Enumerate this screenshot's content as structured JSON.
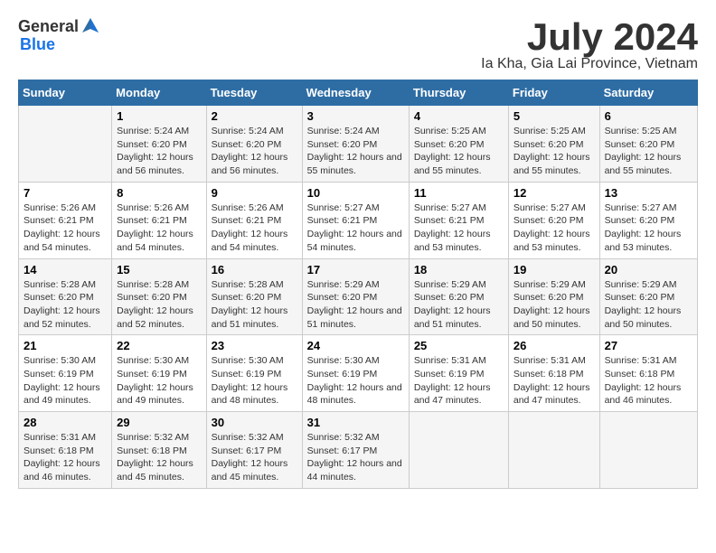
{
  "header": {
    "logo_general": "General",
    "logo_blue": "Blue",
    "month_year": "July 2024",
    "location": "Ia Kha, Gia Lai Province, Vietnam"
  },
  "days_of_week": [
    "Sunday",
    "Monday",
    "Tuesday",
    "Wednesday",
    "Thursday",
    "Friday",
    "Saturday"
  ],
  "weeks": [
    [
      {
        "day": "",
        "sunrise": "",
        "sunset": "",
        "daylight": ""
      },
      {
        "day": "1",
        "sunrise": "Sunrise: 5:24 AM",
        "sunset": "Sunset: 6:20 PM",
        "daylight": "Daylight: 12 hours and 56 minutes."
      },
      {
        "day": "2",
        "sunrise": "Sunrise: 5:24 AM",
        "sunset": "Sunset: 6:20 PM",
        "daylight": "Daylight: 12 hours and 56 minutes."
      },
      {
        "day": "3",
        "sunrise": "Sunrise: 5:24 AM",
        "sunset": "Sunset: 6:20 PM",
        "daylight": "Daylight: 12 hours and 55 minutes."
      },
      {
        "day": "4",
        "sunrise": "Sunrise: 5:25 AM",
        "sunset": "Sunset: 6:20 PM",
        "daylight": "Daylight: 12 hours and 55 minutes."
      },
      {
        "day": "5",
        "sunrise": "Sunrise: 5:25 AM",
        "sunset": "Sunset: 6:20 PM",
        "daylight": "Daylight: 12 hours and 55 minutes."
      },
      {
        "day": "6",
        "sunrise": "Sunrise: 5:25 AM",
        "sunset": "Sunset: 6:20 PM",
        "daylight": "Daylight: 12 hours and 55 minutes."
      }
    ],
    [
      {
        "day": "7",
        "sunrise": "Sunrise: 5:26 AM",
        "sunset": "Sunset: 6:21 PM",
        "daylight": "Daylight: 12 hours and 54 minutes."
      },
      {
        "day": "8",
        "sunrise": "Sunrise: 5:26 AM",
        "sunset": "Sunset: 6:21 PM",
        "daylight": "Daylight: 12 hours and 54 minutes."
      },
      {
        "day": "9",
        "sunrise": "Sunrise: 5:26 AM",
        "sunset": "Sunset: 6:21 PM",
        "daylight": "Daylight: 12 hours and 54 minutes."
      },
      {
        "day": "10",
        "sunrise": "Sunrise: 5:27 AM",
        "sunset": "Sunset: 6:21 PM",
        "daylight": "Daylight: 12 hours and 54 minutes."
      },
      {
        "day": "11",
        "sunrise": "Sunrise: 5:27 AM",
        "sunset": "Sunset: 6:21 PM",
        "daylight": "Daylight: 12 hours and 53 minutes."
      },
      {
        "day": "12",
        "sunrise": "Sunrise: 5:27 AM",
        "sunset": "Sunset: 6:20 PM",
        "daylight": "Daylight: 12 hours and 53 minutes."
      },
      {
        "day": "13",
        "sunrise": "Sunrise: 5:27 AM",
        "sunset": "Sunset: 6:20 PM",
        "daylight": "Daylight: 12 hours and 53 minutes."
      }
    ],
    [
      {
        "day": "14",
        "sunrise": "Sunrise: 5:28 AM",
        "sunset": "Sunset: 6:20 PM",
        "daylight": "Daylight: 12 hours and 52 minutes."
      },
      {
        "day": "15",
        "sunrise": "Sunrise: 5:28 AM",
        "sunset": "Sunset: 6:20 PM",
        "daylight": "Daylight: 12 hours and 52 minutes."
      },
      {
        "day": "16",
        "sunrise": "Sunrise: 5:28 AM",
        "sunset": "Sunset: 6:20 PM",
        "daylight": "Daylight: 12 hours and 51 minutes."
      },
      {
        "day": "17",
        "sunrise": "Sunrise: 5:29 AM",
        "sunset": "Sunset: 6:20 PM",
        "daylight": "Daylight: 12 hours and 51 minutes."
      },
      {
        "day": "18",
        "sunrise": "Sunrise: 5:29 AM",
        "sunset": "Sunset: 6:20 PM",
        "daylight": "Daylight: 12 hours and 51 minutes."
      },
      {
        "day": "19",
        "sunrise": "Sunrise: 5:29 AM",
        "sunset": "Sunset: 6:20 PM",
        "daylight": "Daylight: 12 hours and 50 minutes."
      },
      {
        "day": "20",
        "sunrise": "Sunrise: 5:29 AM",
        "sunset": "Sunset: 6:20 PM",
        "daylight": "Daylight: 12 hours and 50 minutes."
      }
    ],
    [
      {
        "day": "21",
        "sunrise": "Sunrise: 5:30 AM",
        "sunset": "Sunset: 6:19 PM",
        "daylight": "Daylight: 12 hours and 49 minutes."
      },
      {
        "day": "22",
        "sunrise": "Sunrise: 5:30 AM",
        "sunset": "Sunset: 6:19 PM",
        "daylight": "Daylight: 12 hours and 49 minutes."
      },
      {
        "day": "23",
        "sunrise": "Sunrise: 5:30 AM",
        "sunset": "Sunset: 6:19 PM",
        "daylight": "Daylight: 12 hours and 48 minutes."
      },
      {
        "day": "24",
        "sunrise": "Sunrise: 5:30 AM",
        "sunset": "Sunset: 6:19 PM",
        "daylight": "Daylight: 12 hours and 48 minutes."
      },
      {
        "day": "25",
        "sunrise": "Sunrise: 5:31 AM",
        "sunset": "Sunset: 6:19 PM",
        "daylight": "Daylight: 12 hours and 47 minutes."
      },
      {
        "day": "26",
        "sunrise": "Sunrise: 5:31 AM",
        "sunset": "Sunset: 6:18 PM",
        "daylight": "Daylight: 12 hours and 47 minutes."
      },
      {
        "day": "27",
        "sunrise": "Sunrise: 5:31 AM",
        "sunset": "Sunset: 6:18 PM",
        "daylight": "Daylight: 12 hours and 46 minutes."
      }
    ],
    [
      {
        "day": "28",
        "sunrise": "Sunrise: 5:31 AM",
        "sunset": "Sunset: 6:18 PM",
        "daylight": "Daylight: 12 hours and 46 minutes."
      },
      {
        "day": "29",
        "sunrise": "Sunrise: 5:32 AM",
        "sunset": "Sunset: 6:18 PM",
        "daylight": "Daylight: 12 hours and 45 minutes."
      },
      {
        "day": "30",
        "sunrise": "Sunrise: 5:32 AM",
        "sunset": "Sunset: 6:17 PM",
        "daylight": "Daylight: 12 hours and 45 minutes."
      },
      {
        "day": "31",
        "sunrise": "Sunrise: 5:32 AM",
        "sunset": "Sunset: 6:17 PM",
        "daylight": "Daylight: 12 hours and 44 minutes."
      },
      {
        "day": "",
        "sunrise": "",
        "sunset": "",
        "daylight": ""
      },
      {
        "day": "",
        "sunrise": "",
        "sunset": "",
        "daylight": ""
      },
      {
        "day": "",
        "sunrise": "",
        "sunset": "",
        "daylight": ""
      }
    ]
  ]
}
